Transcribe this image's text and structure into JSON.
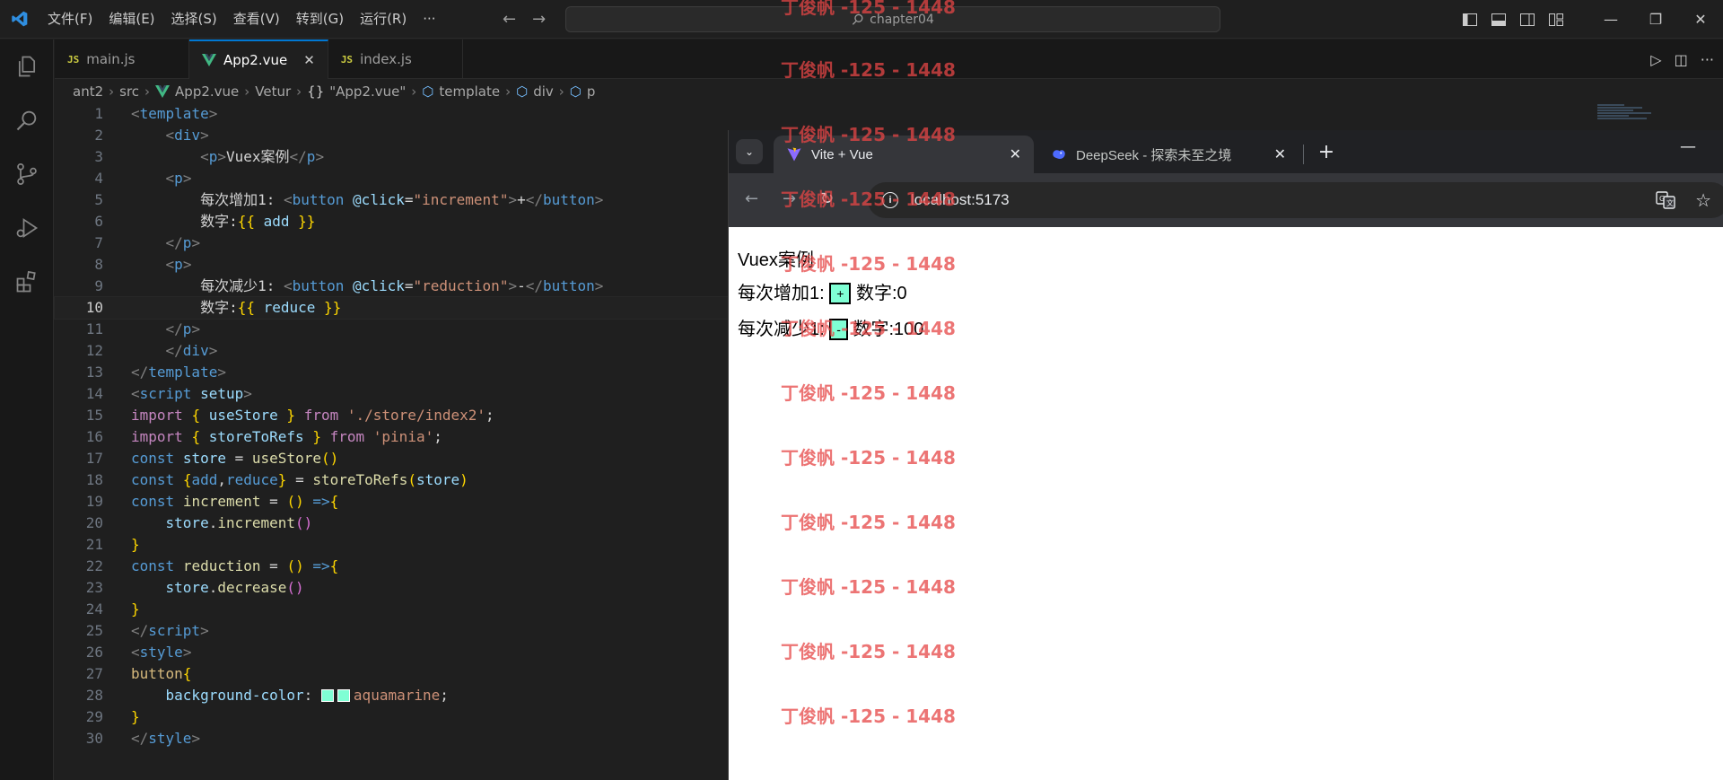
{
  "titlebar": {
    "menu": [
      "文件(F)",
      "编辑(E)",
      "选择(S)",
      "查看(V)",
      "转到(G)",
      "运行(R)",
      "···"
    ],
    "search_text": "chapter04"
  },
  "tabs": [
    {
      "label": "main.js",
      "type": "js"
    },
    {
      "label": "App2.vue",
      "type": "vue",
      "active": true
    },
    {
      "label": "index.js",
      "type": "js"
    }
  ],
  "breadcrumb": [
    "ant2",
    "src",
    "App2.vue",
    "Vetur",
    "\"App2.vue\"",
    "template",
    "div",
    "p"
  ],
  "code_lines": [
    "1",
    "2",
    "3",
    "4",
    "5",
    "6",
    "7",
    "8",
    "9",
    "10",
    "11",
    "12",
    "13",
    "14",
    "15",
    "16",
    "17",
    "18",
    "19",
    "20",
    "21",
    "22",
    "23",
    "24",
    "25",
    "26",
    "27",
    "28",
    "29",
    "30"
  ],
  "browser": {
    "tabs": [
      {
        "title": "Vite + Vue",
        "active": true
      },
      {
        "title": "DeepSeek - 探索未至之境",
        "active": false
      }
    ],
    "url": "localhost:5173",
    "page": {
      "heading": "Vuex案例",
      "inc_label": "每次增加1:",
      "inc_button": "+",
      "inc_value_label": "数字:0",
      "dec_label": "每次减少1:",
      "dec_button": "-",
      "dec_value_label": "数字:100"
    }
  },
  "watermark": "丁俊帆 -125 - 1448",
  "colors": {
    "accent": "#0078d4",
    "button_bg": "#7fffd4"
  }
}
